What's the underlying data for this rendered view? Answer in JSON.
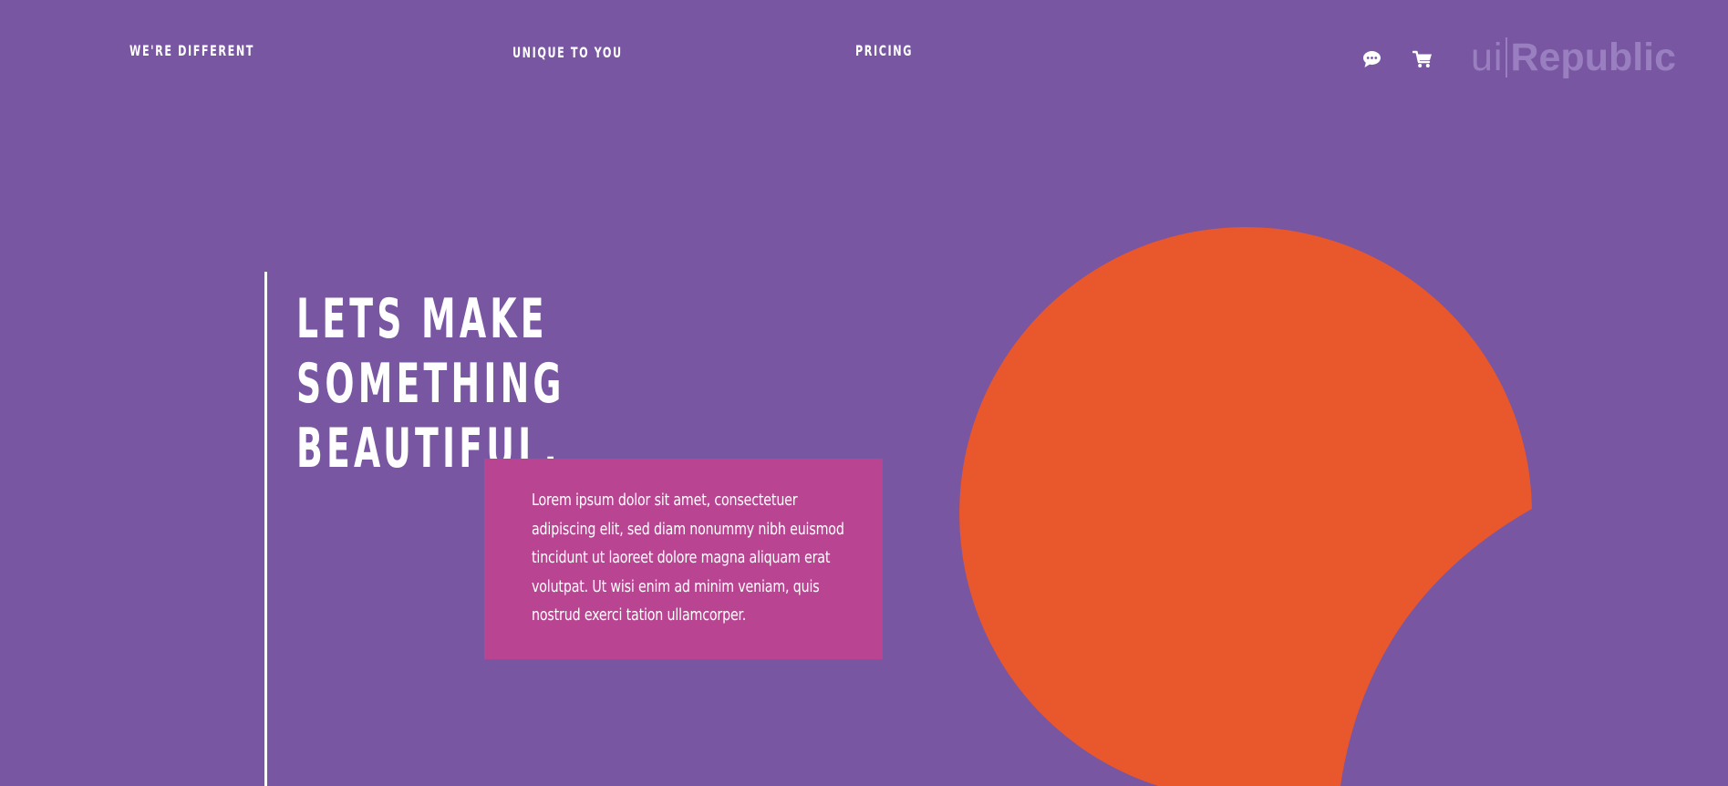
{
  "theme": {
    "background": "#7856a1",
    "accent_orange": "#e9572c",
    "accent_pink": "#b94592",
    "text_white": "#ffffff",
    "logo_color": "#9a7fc0"
  },
  "nav": {
    "items": [
      {
        "label": "WE'RE DIFFERENT"
      },
      {
        "label": "UNIQUE TO YOU"
      },
      {
        "label": "PRICING"
      }
    ],
    "chat_icon": "chat-bubble-icon",
    "cart_icon": "shopping-cart-icon"
  },
  "logo": {
    "prefix": "ui",
    "brand": "Republic"
  },
  "hero": {
    "headline": [
      "LETS MAKE",
      "SOMETHING",
      "BEAUTIFUL."
    ],
    "body": "Lorem ipsum dolor sit amet, consectetuer adipiscing elit, sed diam nonummy nibh euismod tincidunt ut laoreet dolore magna aliquam erat volutpat. Ut wisi enim ad minim veniam, quis nostrud exerci tation ullamcorper."
  }
}
